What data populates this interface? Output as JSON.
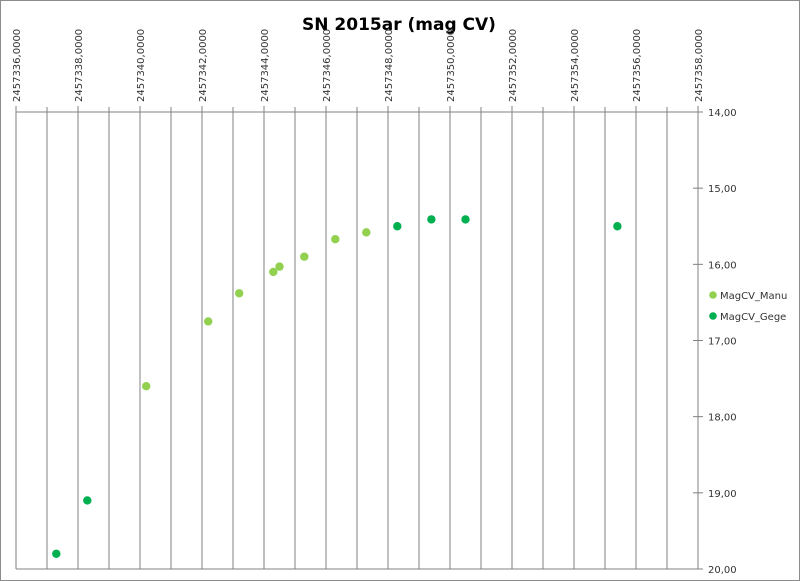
{
  "chart_data": {
    "type": "scatter",
    "title": "SN 2015ar (mag CV)",
    "xlabel": "",
    "ylabel": "",
    "xlim": [
      2457336,
      2457358
    ],
    "ylim": [
      14,
      20
    ],
    "y_reversed": true,
    "x_axis_position": "top",
    "y_axis_position": "right",
    "x_tick_values": [
      2457336,
      2457338,
      2457340,
      2457342,
      2457344,
      2457346,
      2457348,
      2457350,
      2457352,
      2457354,
      2457356,
      2457358
    ],
    "x_tick_labels": [
      "2457336,0000",
      "2457338,0000",
      "2457340,0000",
      "2457342,0000",
      "2457344,0000",
      "2457346,0000",
      "2457348,0000",
      "2457350,0000",
      "2457352,0000",
      "2457354,0000",
      "2457356,0000",
      "2457358,0000"
    ],
    "y_tick_values": [
      14,
      15,
      16,
      17,
      18,
      19,
      20
    ],
    "y_tick_labels": [
      "14,00",
      "15,00",
      "16,00",
      "17,00",
      "18,00",
      "19,00",
      "20,00"
    ],
    "grid": "vertical",
    "legend_position": "right",
    "series": [
      {
        "name": "MagCV_Manu",
        "color": "#92d050",
        "points": [
          {
            "x": 2457340.2,
            "y": 17.6
          },
          {
            "x": 2457342.2,
            "y": 16.75
          },
          {
            "x": 2457343.2,
            "y": 16.38
          },
          {
            "x": 2457344.3,
            "y": 16.1
          },
          {
            "x": 2457344.5,
            "y": 16.03
          },
          {
            "x": 2457345.3,
            "y": 15.9
          },
          {
            "x": 2457346.3,
            "y": 15.67
          },
          {
            "x": 2457347.3,
            "y": 15.58
          }
        ]
      },
      {
        "name": "MagCV_Gege",
        "color": "#00b050",
        "points": [
          {
            "x": 2457337.3,
            "y": 19.8
          },
          {
            "x": 2457338.3,
            "y": 19.1
          },
          {
            "x": 2457348.3,
            "y": 15.5
          },
          {
            "x": 2457349.4,
            "y": 15.41
          },
          {
            "x": 2457350.5,
            "y": 15.41
          },
          {
            "x": 2457355.4,
            "y": 15.5
          }
        ]
      }
    ]
  }
}
